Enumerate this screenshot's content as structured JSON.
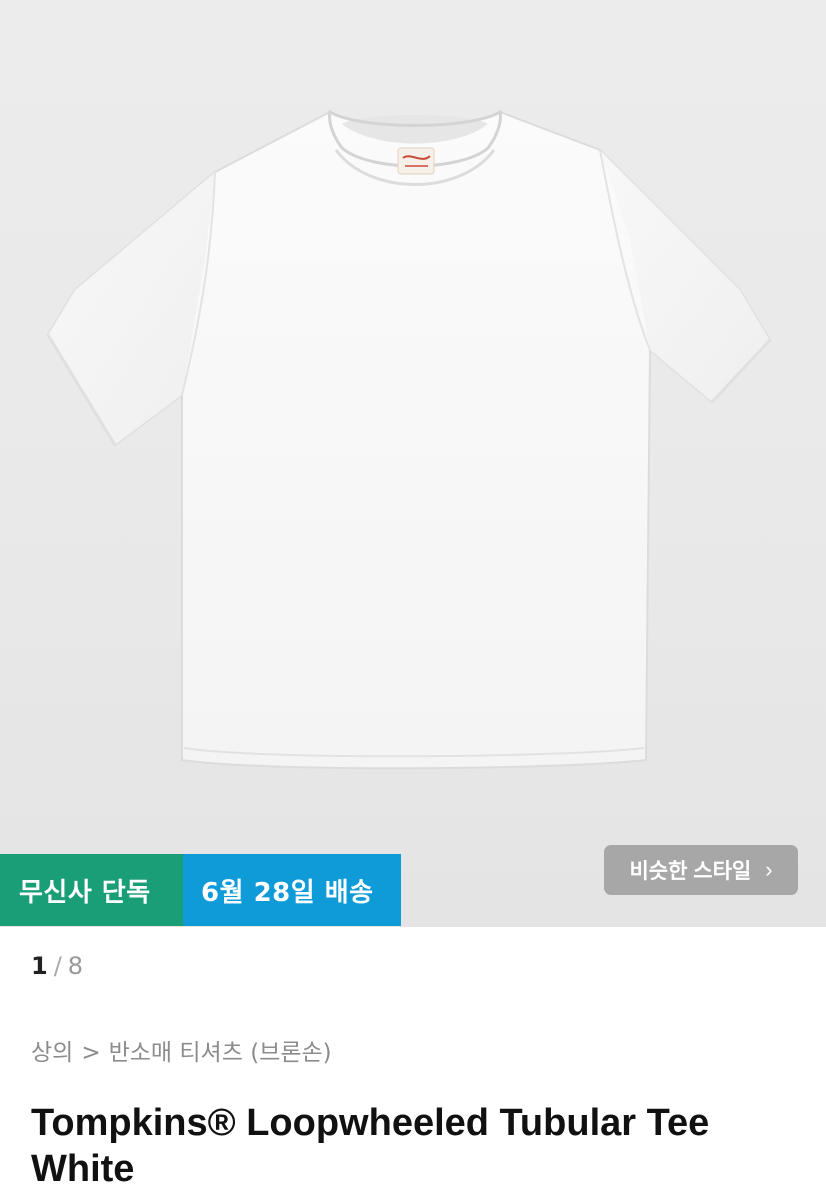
{
  "product_image": {
    "alt_icon": "white-tshirt-image",
    "label_tag": "Tompkins"
  },
  "badges": {
    "exclusive": "무신사 단독",
    "delivery": "6월 28일 배송",
    "exclusive_color": "#1a9e77",
    "delivery_color": "#0f9ad8"
  },
  "similar_style": {
    "label": "비슷한 스타일",
    "icon": "chevron-right-icon",
    "chevron": "›"
  },
  "pager": {
    "current": "1",
    "separator": "/",
    "total": "8"
  },
  "breadcrumb": {
    "category": "상의",
    "arrow": ">",
    "subcategory": "반소매 티셔츠 (브론손)"
  },
  "product": {
    "title": "Tompkins® Loopwheeled Tubular Tee White"
  }
}
